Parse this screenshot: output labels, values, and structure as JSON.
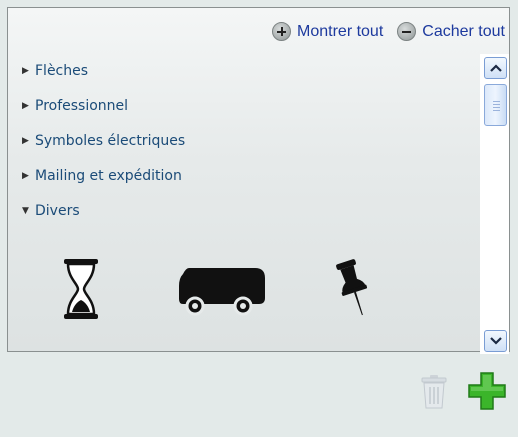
{
  "header": {
    "show_all_label": "Montrer tout",
    "hide_all_label": "Cacher tout"
  },
  "tree": {
    "items": [
      {
        "label": "Flèches",
        "expanded": false
      },
      {
        "label": "Professionnel",
        "expanded": false
      },
      {
        "label": "Symboles électriques",
        "expanded": false
      },
      {
        "label": "Mailing et expédition",
        "expanded": false
      },
      {
        "label": "Divers",
        "expanded": true
      }
    ]
  },
  "shapes": [
    {
      "icon": "hourglass-icon"
    },
    {
      "icon": "bus-icon"
    },
    {
      "icon": "pushpin-icon"
    }
  ],
  "scroll": {
    "position": 0.05
  },
  "colors": {
    "link": "#1d3a9e",
    "tree_text": "#1b4b78",
    "add_green": "#3bb52a",
    "scroll_blue": "#7a9dd4"
  },
  "footer": {
    "delete_icon": "trash-icon",
    "add_icon": "plus-icon"
  }
}
